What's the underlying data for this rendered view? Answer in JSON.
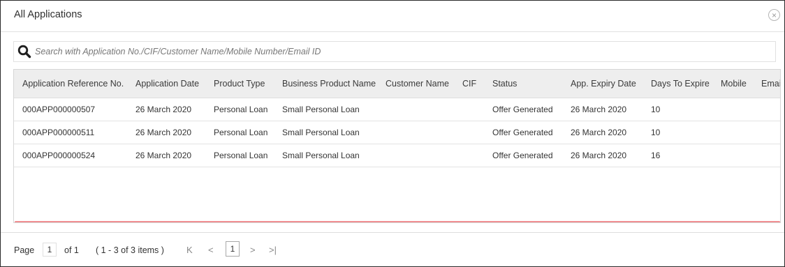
{
  "dialog": {
    "title": "All Applications",
    "close_symbol": "×"
  },
  "search": {
    "placeholder": "Search with Application No./CIF/Customer Name/Mobile Number/Email ID",
    "value": ""
  },
  "table": {
    "columns": [
      "Application Reference No.",
      "Application Date",
      "Product Type",
      "Business Product Name",
      "Customer Name",
      "CIF",
      "Status",
      "App. Expiry Date",
      "Days To Expire",
      "Mobile",
      "Email"
    ],
    "rows": [
      [
        "000APP000000507",
        "26 March 2020",
        "Personal Loan",
        "Small Personal Loan",
        "",
        "",
        "Offer Generated",
        "26 March 2020",
        "10",
        "",
        ""
      ],
      [
        "000APP000000511",
        "26 March 2020",
        "Personal Loan",
        "Small Personal Loan",
        "",
        "",
        "Offer Generated",
        "26 March 2020",
        "10",
        "",
        ""
      ],
      [
        "000APP000000524",
        "26 March 2020",
        "Personal Loan",
        "Small Personal Loan",
        "",
        "",
        "Offer Generated",
        "26 March 2020",
        "16",
        "",
        ""
      ]
    ]
  },
  "pager": {
    "page_label": "Page",
    "page_value": "1",
    "of_label": "of 1",
    "items_label": "( 1 - 3 of 3 items )",
    "first_icon": "K",
    "prev_icon": "<",
    "current_page": "1",
    "next_icon": ">",
    "last_icon": ">|"
  },
  "colors": {
    "header_bg": "#eeeeee",
    "scrollbar": "#f08f92",
    "border": "#d6d6d6"
  }
}
